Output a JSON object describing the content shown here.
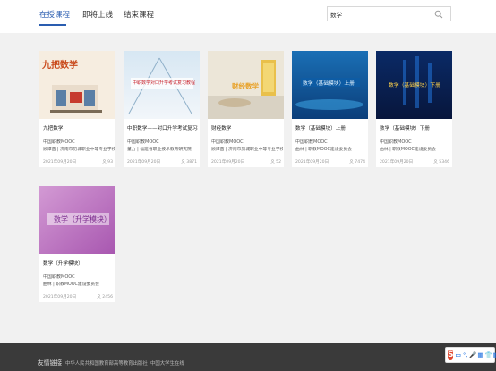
{
  "tabs": [
    {
      "label": "在授课程",
      "active": true
    },
    {
      "label": "即将上线",
      "active": false
    },
    {
      "label": "结束课程",
      "active": false
    }
  ],
  "search": {
    "value": "数学",
    "icon": "search-icon"
  },
  "courses": [
    {
      "title": "九把数学",
      "school": "中国职教MOOC",
      "teacher": "顾谭茵 | 济南市历城职业中等专业学校",
      "date": "2021年09月20日",
      "count": "93",
      "thumb_text": "九把数学"
    },
    {
      "title": "中职数学——对口升学考试复习教程",
      "school": "中国职教MOOC",
      "teacher": "董力 | 福建省职业技术教育研究院",
      "date": "2021年09月20日",
      "count": "3871",
      "thumb_text": "中职数学对口升学考试复习教程"
    },
    {
      "title": "财经数学",
      "school": "中国职教MOOC",
      "teacher": "顾谭茵 | 济南市历城职业中等专业学校",
      "date": "2021年09月20日",
      "count": "52",
      "thumb_text": "财经数学"
    },
    {
      "title": "数学（基础模块）上册",
      "school": "中国职教MOOC",
      "teacher": "曲林 | 职教MOOC建设委员会",
      "date": "2021年09月20日",
      "count": "7474",
      "thumb_text": "数学（基础模块）上册"
    },
    {
      "title": "数学（基础模块）下册",
      "school": "中国职教MOOC",
      "teacher": "曲林 | 职教MOOC建设委员会",
      "date": "2021年09月20日",
      "count": "5346",
      "thumb_text": "数学（基础模块）下册"
    },
    {
      "title": "数学（升学模块）",
      "school": "中国职教MOOC",
      "teacher": "曲林 | 职教MOOC建设委员会",
      "date": "2021年09月20日",
      "count": "2456",
      "thumb_text": "数学（升学模块）"
    }
  ],
  "footer": {
    "title": "友情链接",
    "links": [
      "中华人民共和国教育部",
      "高等教育出版社",
      "中国大学生在线"
    ]
  },
  "ime": {
    "logo": "S",
    "items": [
      "中",
      "°,",
      "🎤",
      "▦",
      "👕",
      "▦"
    ]
  }
}
